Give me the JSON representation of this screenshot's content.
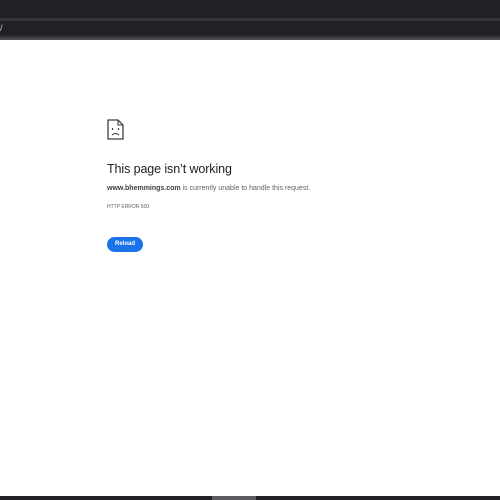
{
  "browser": {
    "address_text": "/"
  },
  "error_page": {
    "icon": "sad-page-icon",
    "title": "This page isn’t working",
    "domain": "www.bhemmings.com",
    "message": " is currently unable to handle this request.",
    "error_code": "HTTP ERROR 500",
    "reload_label": "Reload"
  },
  "colors": {
    "accent": "#1a73e8",
    "browser_chrome": "#202124",
    "toolbar": "#35363a"
  }
}
